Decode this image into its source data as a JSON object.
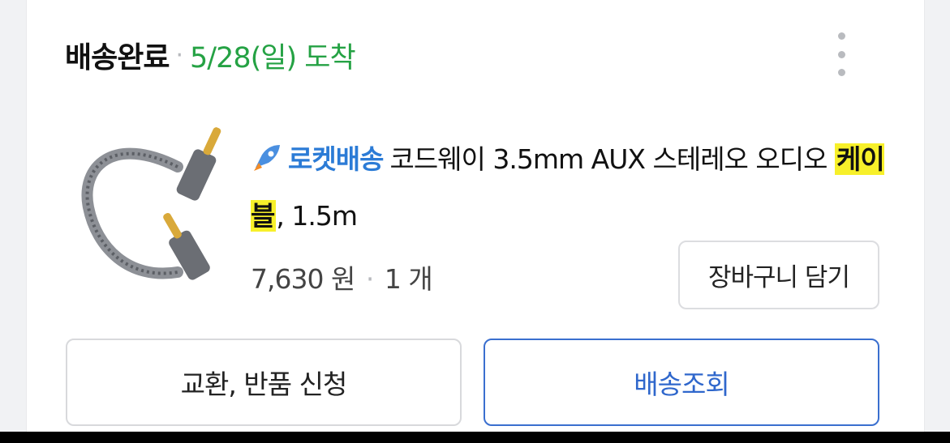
{
  "order": {
    "status": "배송완료",
    "separator": "·",
    "arrival": "5/28(일) 도착",
    "more_icon": "more-vertical-icon"
  },
  "product": {
    "image_icon": "aux-cable-thumbnail",
    "badge_label": "로켓배송",
    "badge_icon": "rocket-icon",
    "name_before": "코드웨이 3.5mm AUX 스테레오 오디오 ",
    "name_highlight": "케이블",
    "name_after": ", 1.5m",
    "price": "7,630 원",
    "separator": "·",
    "quantity": "1 개",
    "cart_button": "장바구니 담기"
  },
  "actions": {
    "return_button": "교환, 반품 신청",
    "track_button": "배송조회"
  },
  "colors": {
    "arrival_green": "#25a244",
    "rocket_blue": "#2b7bd6",
    "highlight_yellow": "#f7f02a",
    "track_blue": "#2f67cc"
  }
}
